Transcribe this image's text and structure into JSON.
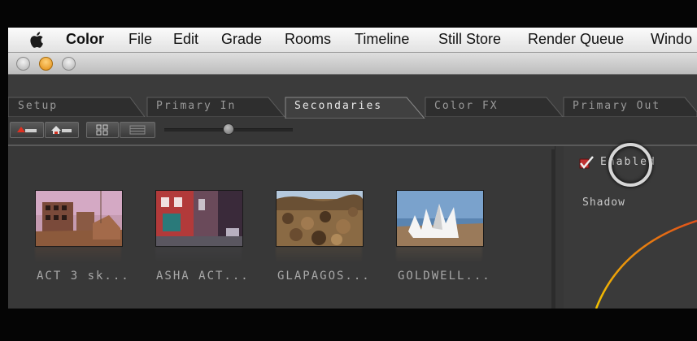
{
  "menubar": {
    "app_name": "Color",
    "items": [
      "File",
      "Edit",
      "Grade",
      "Rooms",
      "Timeline",
      "Still Store",
      "Render Queue",
      "Windo"
    ]
  },
  "tabs": [
    {
      "label": "Setup",
      "active": false
    },
    {
      "label": "Primary In",
      "active": false
    },
    {
      "label": "Secondaries",
      "active": true
    },
    {
      "label": "Color FX",
      "active": false
    },
    {
      "label": "Primary Out",
      "active": false
    }
  ],
  "browser": {
    "slider_value": 0.5,
    "clips": [
      {
        "label": "ACT 3 sk..."
      },
      {
        "label": "ASHA ACT..."
      },
      {
        "label": "GLAPAGOS..."
      },
      {
        "label": "GOLDWELL..."
      }
    ]
  },
  "panel": {
    "enabled_label": "Enabled",
    "shadow_label": "Shadow"
  },
  "colors": {
    "accent_close": "#e08a10",
    "curve_start": "#f2c200",
    "curve_end": "#e0501a"
  }
}
